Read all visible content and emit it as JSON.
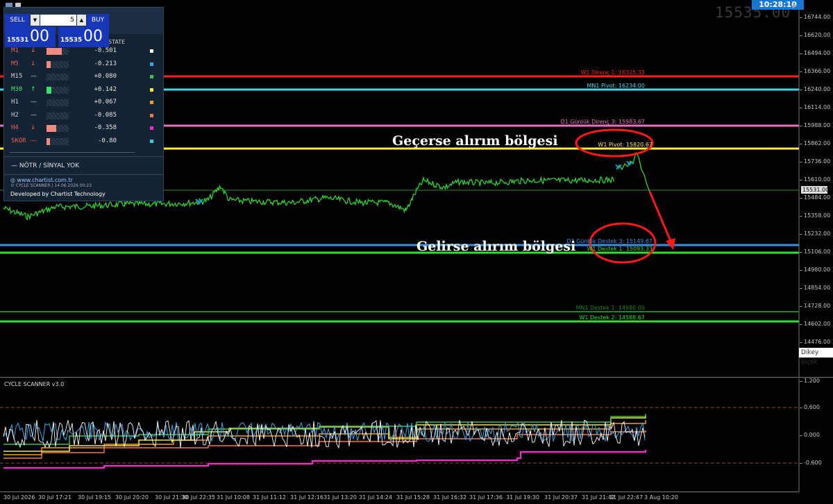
{
  "topbar": {
    "clock": "10:28:10",
    "symbol_price": "15535.00"
  },
  "trade_panel": {
    "sell_label": "SELL",
    "buy_label": "BUY",
    "lot_value": "5",
    "sell_price_small": "15531",
    "sell_price_big": "00",
    "buy_price_small": "15535",
    "buy_price_big": "00"
  },
  "scanner": {
    "state_header": "STATE",
    "rows": [
      {
        "tf": "M1",
        "arrow": "↓",
        "value": "-0.501",
        "color": "#e8605a",
        "bar": 0.7,
        "bar_color": "#f28b82",
        "dot": "#ffffff"
      },
      {
        "tf": "M5",
        "arrow": "↓",
        "value": "-0.213",
        "color": "#e8605a",
        "bar": 0.2,
        "bar_color": "#f28b82",
        "dot": "#3aa7e8"
      },
      {
        "tf": "M15",
        "arrow": "—",
        "value": "+0.080",
        "color": "#cfcfcf",
        "bar": 0.0,
        "bar_color": "#888888",
        "dot": "#3cc45a"
      },
      {
        "tf": "M30",
        "arrow": "↑",
        "value": "+0.142",
        "color": "#3ce06a",
        "bar": 0.22,
        "bar_color": "#3ce06a",
        "dot": "#f4ec2a"
      },
      {
        "tf": "H1",
        "arrow": "—",
        "value": "+0.067",
        "color": "#cfcfcf",
        "bar": 0.0,
        "bar_color": "#888888",
        "dot": "#f4a021"
      },
      {
        "tf": "H2",
        "arrow": "—",
        "value": "-0.085",
        "color": "#cfcfcf",
        "bar": 0.0,
        "bar_color": "#888888",
        "dot": "#ef7a4a"
      },
      {
        "tf": "H4",
        "arrow": "↓",
        "value": "-0.358",
        "color": "#e8605a",
        "bar": 0.45,
        "bar_color": "#f28b82",
        "dot": "#ff2ad0"
      },
      {
        "tf": "SKOR",
        "arrow": "—",
        "value": "-0.80",
        "color": "#e8605a",
        "bar": 0.15,
        "bar_color": "#f28b82",
        "dot": "#2ad0e0"
      }
    ],
    "status": "—   NÖTR  /  SİNYAL YOK",
    "website": "www.chartist.com.tr",
    "version_line": "© CYCLE SCANNER | 14.06.2026 00:23",
    "developer": "Developed by Chartist Technology"
  },
  "price_axis": [
    "16744.00",
    "16620.00",
    "16494.00",
    "16366.00",
    "16240.00",
    "16114.00",
    "15988.00",
    "15862.00",
    "15736.00",
    "15610.00",
    "15484.00",
    "15358.00",
    "15232.00",
    "15106.00",
    "14980.00",
    "14854.00",
    "14728.00",
    "14602.00",
    "14476.00"
  ],
  "current_price_tag": "15531.00",
  "levels": [
    {
      "label": "W1 Direnç 1: 16325.33",
      "color": "#ff2020"
    },
    {
      "label": "MN1 Pivot: 16234.00",
      "color": "#3fd8ea"
    },
    {
      "label": "D1 Günlük Direnç 3: 15983.67",
      "color": "#ee6fc0"
    },
    {
      "label": "W1 Pivot: 15820.67",
      "color": "#ffee33"
    },
    {
      "label": "D1 Günlük Destek 3: 15149.67",
      "color": "#3b8fe8"
    },
    {
      "label": "W1 Destek 1: 15093.33",
      "color": "#30e030"
    },
    {
      "label": "MN1 Destek 1: 14680.00",
      "color": "#1a8a1a"
    },
    {
      "label": "W1 Destek 2: 14588.67",
      "color": "#30e030"
    }
  ],
  "annotations": {
    "upper_note": "Geçerse alırım bölgesi",
    "lower_note": "Gelirse alırım bölgesi"
  },
  "vertical_scale_tip": "Dikey ölçek",
  "subwindow": {
    "title": "CYCLE SCANNER v3.0",
    "axis": [
      "1.200",
      "0.600",
      "0.000",
      "-0.600"
    ]
  },
  "time_axis": [
    "30 Jul 2026",
    "30 Jul 17:21",
    "30 Jul 19:15",
    "30 Jul 20:20",
    "30 Jul 21:30",
    "30 Jul 22:35",
    "31 Jul 10:08",
    "31 Jul 11:12",
    "31 Jul 12:16",
    "31 Jul 13:20",
    "31 Jul 14:24",
    "31 Jul 15:28",
    "31 Jul 16:32",
    "31 Jul 17:36",
    "31 Jul 19:30",
    "31 Jul 20:37",
    "31 Jul 21:42",
    "31 Jul 22:47",
    "3 Aug 10:20"
  ]
}
